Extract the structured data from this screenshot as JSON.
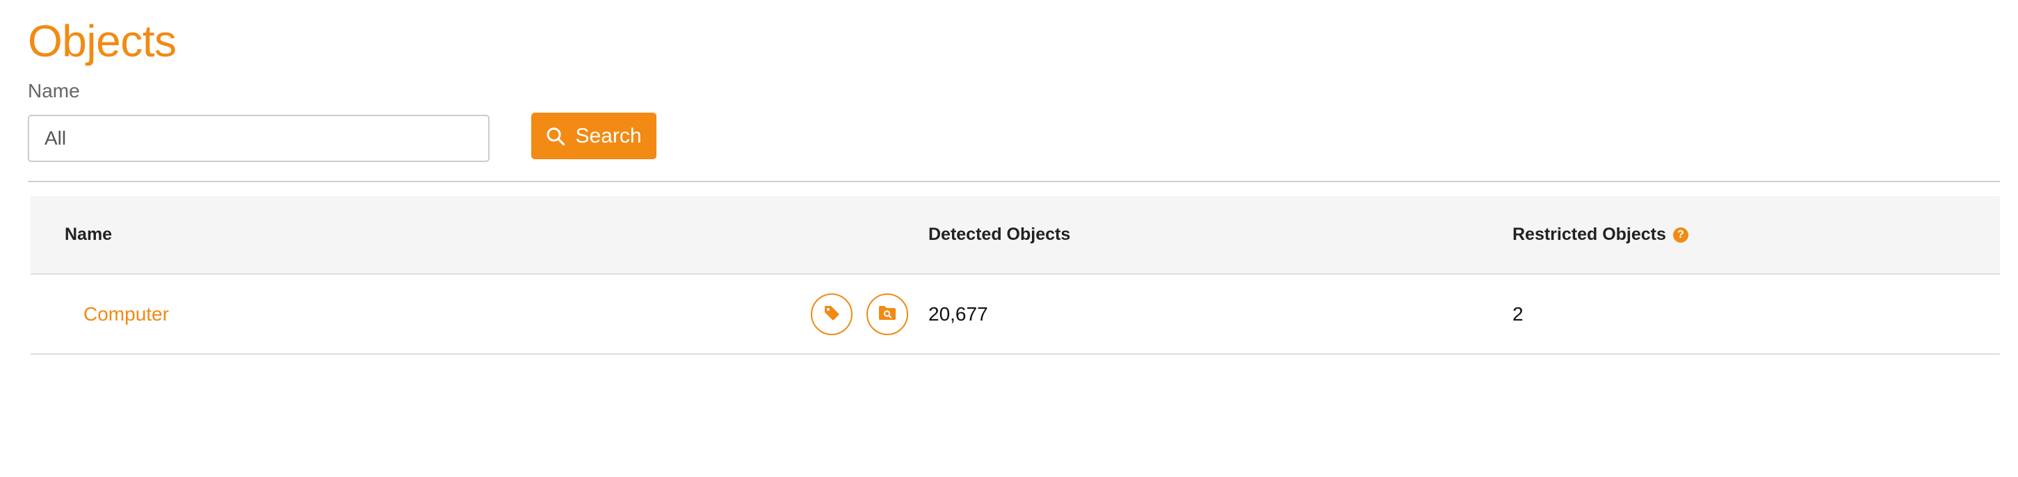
{
  "page": {
    "title": "Objects"
  },
  "filter": {
    "label": "Name",
    "value": "All",
    "search_label": "Search",
    "search_icon": "search-icon"
  },
  "table": {
    "columns": {
      "name": "Name",
      "detected": "Detected Objects",
      "restricted": "Restricted Objects",
      "help_icon": "?"
    },
    "rows": [
      {
        "name": "Computer",
        "detected": "20,677",
        "restricted": "2",
        "actions": [
          "tag-icon",
          "folder-search-icon"
        ]
      }
    ]
  },
  "colors": {
    "accent": "#f28a14",
    "header_bg": "#f5f5f5",
    "border": "#dedede"
  }
}
